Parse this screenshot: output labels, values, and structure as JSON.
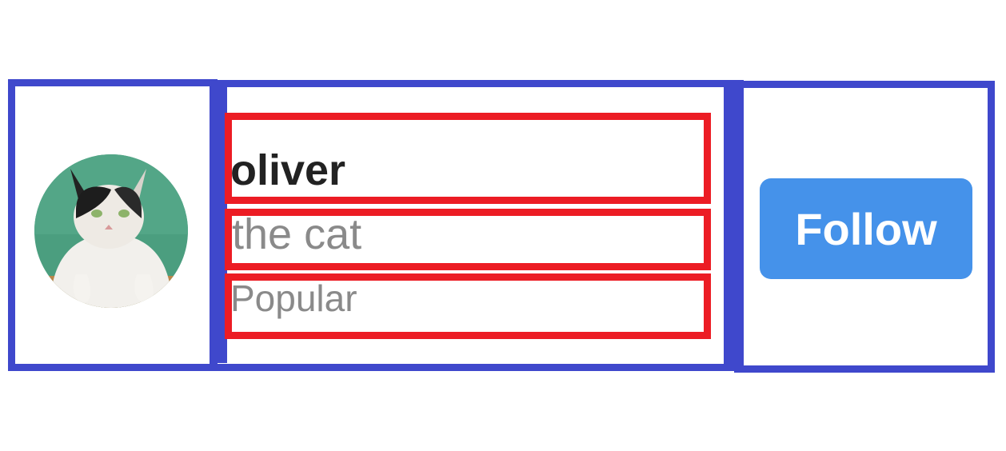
{
  "profile": {
    "name": "oliver",
    "bio": "the cat",
    "tag": "Popular",
    "avatar_icon": "cat-photo-avatar"
  },
  "actions": {
    "follow_label": "Follow"
  },
  "colors": {
    "column_outline": "#3f48cc",
    "text_outline": "#ec1c24",
    "follow_button": "#4592ea",
    "name_text": "#222222",
    "muted_text": "#8a8a8a"
  }
}
